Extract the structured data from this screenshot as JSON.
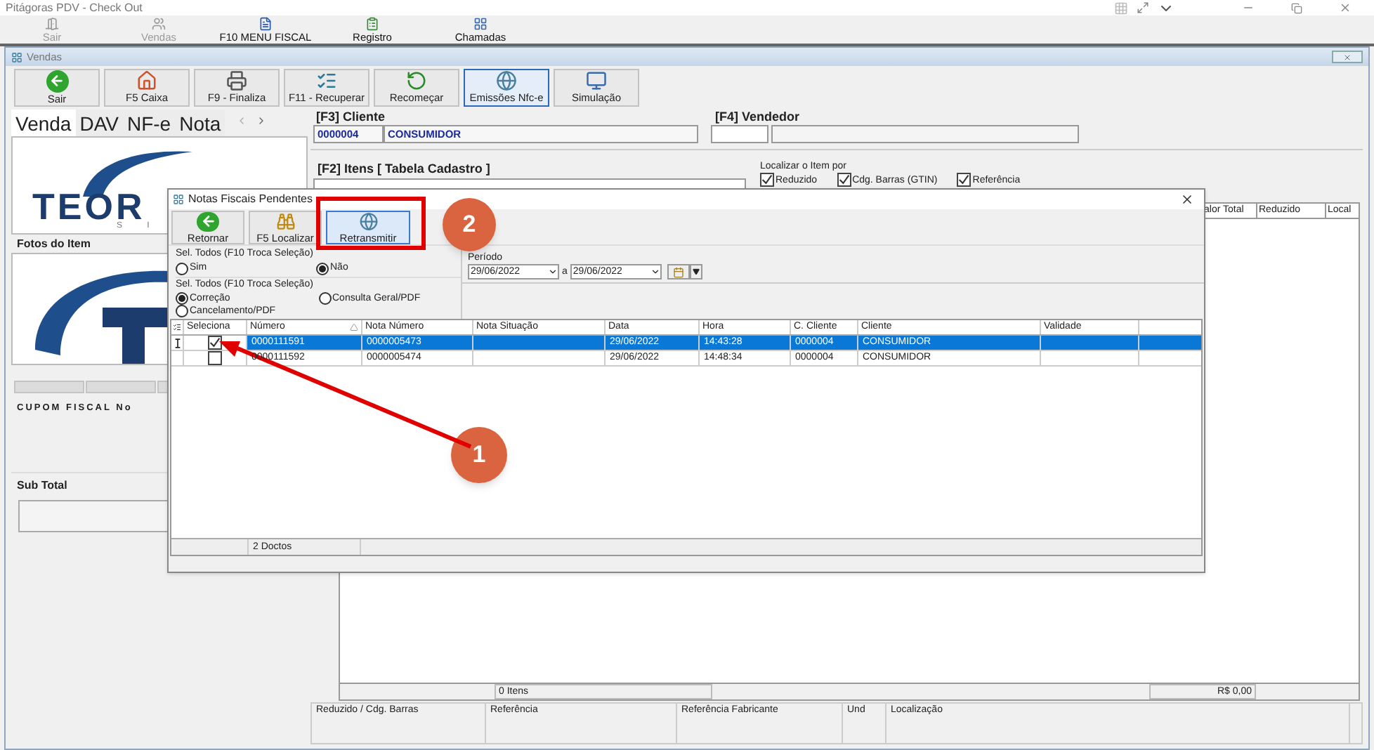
{
  "window": {
    "title": "Pitágoras PDV - Check Out"
  },
  "menu": [
    {
      "label": "Sair",
      "disabled": true
    },
    {
      "label": "Vendas",
      "disabled": true
    },
    {
      "label": "F10 MENU FISCAL",
      "disabled": false
    },
    {
      "label": "Registro",
      "disabled": false
    },
    {
      "label": "Chamadas",
      "disabled": false
    }
  ],
  "sales_window": {
    "title": "Vendas"
  },
  "toolbar": [
    {
      "label": "Sair",
      "kind": "exit",
      "selected": false
    },
    {
      "label": "F5 Caixa",
      "kind": "home",
      "selected": false
    },
    {
      "label": "F9 - Finaliza",
      "kind": "print",
      "selected": false
    },
    {
      "label": "F11 - Recuperar",
      "kind": "list",
      "selected": false
    },
    {
      "label": "Recomeçar",
      "kind": "restart",
      "selected": false
    },
    {
      "label": "Emissões Nfc-e",
      "kind": "globe",
      "selected": true
    },
    {
      "label": "Simulação",
      "kind": "monitor",
      "selected": false
    }
  ],
  "left_tabs": [
    {
      "label": "Venda",
      "selected": true
    },
    {
      "label": "DAV",
      "selected": false
    },
    {
      "label": "NF-e",
      "selected": false
    },
    {
      "label": "Nota",
      "selected": false
    }
  ],
  "logo": {
    "text": "TEOR",
    "subtext": "S I"
  },
  "photos_label": "Fotos do Item",
  "receipt_label": "CUPOM FISCAL No",
  "subtotal_label": "Sub Total",
  "client": {
    "label": "[F3] Cliente",
    "code": "0000004",
    "name": "CONSUMIDOR"
  },
  "seller": {
    "label": "[F4] Vendedor"
  },
  "items": {
    "label": "[F2] Itens [ Tabela Cadastro ]",
    "search_by_label": "Localizar o Item por",
    "search_by": [
      {
        "label": "Reduzido",
        "checked": true
      },
      {
        "label": "Cdg. Barras (GTIN)",
        "checked": true
      },
      {
        "label": "Referência",
        "checked": true
      }
    ],
    "columns": [
      "alor Total",
      "Reduzido",
      "Local"
    ],
    "count": "0 Itens",
    "total": "R$ 0,00"
  },
  "details_columns": [
    "Reduzido / Cdg. Barras",
    "Referência",
    "Referência Fabricante",
    "Und",
    "Localização"
  ],
  "dialog": {
    "title": "Notas Fiscais Pendentes",
    "buttons": [
      {
        "label": "Retornar",
        "kind": "back",
        "selected": false
      },
      {
        "label": "F5 Localizar",
        "kind": "find",
        "selected": false
      },
      {
        "label": "Retransmitir",
        "kind": "globe",
        "selected": true
      }
    ],
    "select_all": {
      "label": "Sel. Todos (F10 Troca Seleção)",
      "options": [
        {
          "label": "Sim",
          "selected": false
        },
        {
          "label": "Não",
          "selected": true
        }
      ]
    },
    "select_type": {
      "label": "Sel. Todos (F10 Troca Seleção)",
      "options": [
        {
          "label": "Correção",
          "selected": true
        },
        {
          "label": "Consulta Geral/PDF",
          "selected": false
        },
        {
          "label": "Cancelamento/PDF",
          "selected": false
        }
      ]
    },
    "period": {
      "label": "Período",
      "from": "29/06/2022",
      "between": "a",
      "to": "29/06/2022"
    },
    "selection_header": "Seleciona",
    "columns": [
      {
        "label": "Número",
        "sorted": true
      },
      {
        "label": "Nota Número",
        "sorted": false
      },
      {
        "label": "Nota Situação",
        "sorted": false
      },
      {
        "label": "Data",
        "sorted": false
      },
      {
        "label": "Hora",
        "sorted": false
      },
      {
        "label": "C. Cliente",
        "sorted": false
      },
      {
        "label": "Cliente",
        "sorted": false
      },
      {
        "label": "Validade",
        "sorted": false
      }
    ],
    "rows": [
      {
        "selected": true,
        "checked": true,
        "cells": [
          "0000111591",
          "0000005473",
          "",
          "29/06/2022",
          "14:43:28",
          "0000004",
          "CONSUMIDOR",
          ""
        ]
      },
      {
        "selected": false,
        "checked": false,
        "cells": [
          "0000111592",
          "0000005474",
          "",
          "29/06/2022",
          "14:48:34",
          "0000004",
          "CONSUMIDOR",
          ""
        ]
      }
    ],
    "count": "2 Doctos"
  },
  "annotations": [
    {
      "label": "1"
    },
    {
      "label": "2"
    }
  ]
}
